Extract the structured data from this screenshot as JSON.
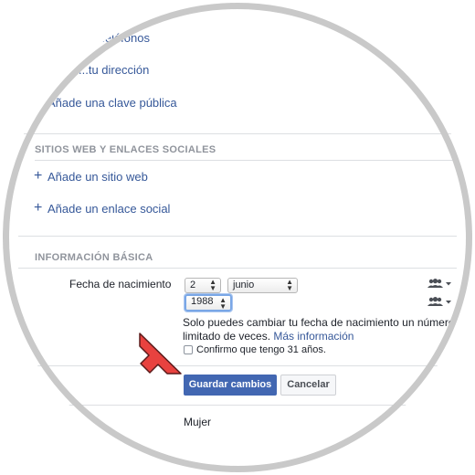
{
  "contact": {
    "phones_link": "...eléfonos",
    "address_link": "...tu dirección",
    "public_key_link": "Añade una clave pública"
  },
  "websites": {
    "section_title": "SITIOS WEB Y ENLACES SOCIALES",
    "add_website": "Añade un sitio web",
    "add_social": "Añade un enlace social"
  },
  "basic": {
    "section_title": "INFORMACIÓN BÁSICA",
    "birth_label": "Fecha de nacimiento",
    "day_value": "2",
    "month_value": "junio",
    "year_value": "1988",
    "note_line1": "Solo puedes cambiar tu fecha de nacimiento un número",
    "note_line2": "limitado de veces.",
    "more_info": "Más información",
    "confirm_label": "Confirmo que tengo 31 años.",
    "save_label": "Guardar cambios",
    "cancel_label": "Cancelar",
    "gender_value": "Mujer"
  },
  "icons": {
    "audience": "friends-audience-icon",
    "dropdown": "caret-down-icon",
    "plus": "plus-icon",
    "pointer_arrow": "red-arrow-icon"
  },
  "colors": {
    "link": "#365899",
    "primary_button": "#4267b2",
    "arrow": "#e8423f"
  }
}
